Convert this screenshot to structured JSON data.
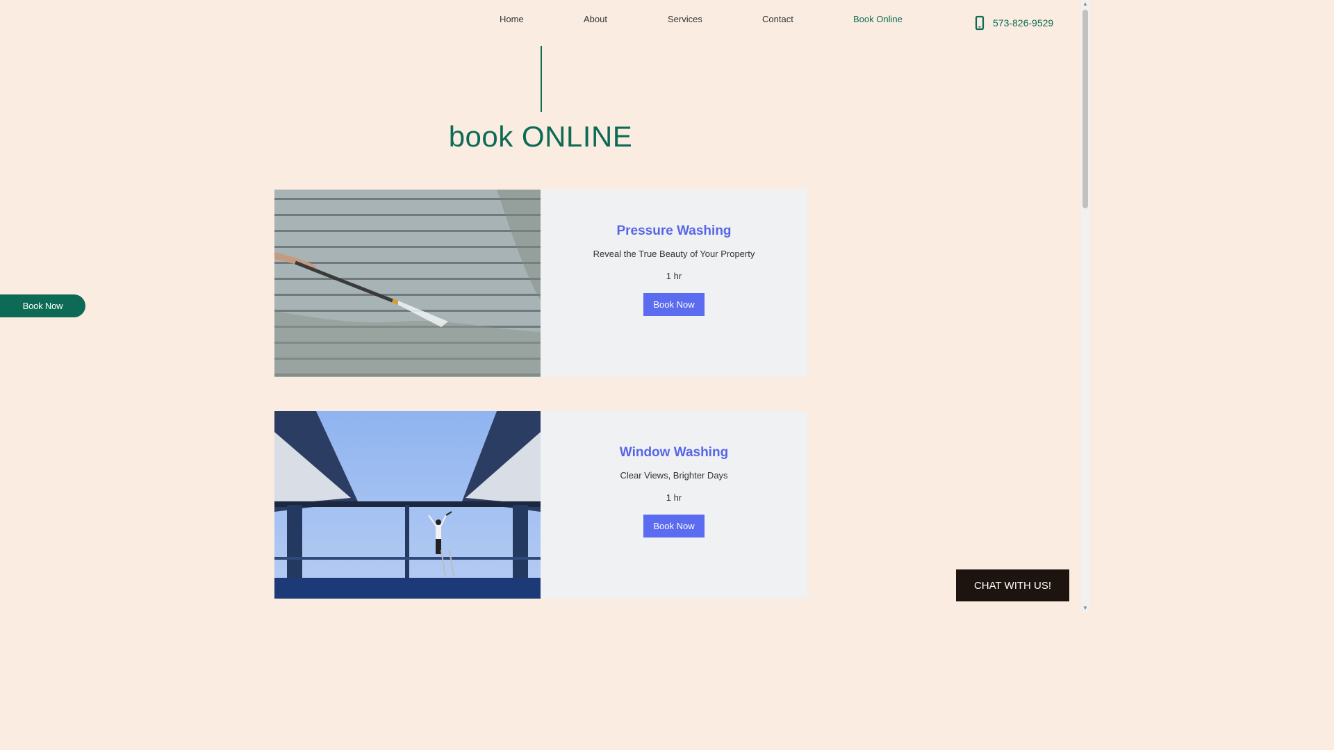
{
  "nav": {
    "items": [
      {
        "label": "Home"
      },
      {
        "label": "About"
      },
      {
        "label": "Services"
      },
      {
        "label": "Contact"
      },
      {
        "label": "Book Online",
        "active": true
      }
    ],
    "phone": {
      "icon": "phone-icon",
      "number": "573-826-9529"
    }
  },
  "page": {
    "title": "book ONLINE"
  },
  "services": [
    {
      "title": "Pressure Washing",
      "subtitle": "Reveal the True Beauty of Your Property",
      "duration": "1 hr",
      "button": "Book Now",
      "image": "pressure-washing-photo"
    },
    {
      "title": "Window Washing",
      "subtitle": "Clear Views, Brighter Days",
      "duration": "1 hr",
      "button": "Book Now",
      "image": "window-washing-photo"
    }
  ],
  "side_button": {
    "label": "Book Now"
  },
  "chat": {
    "label": "CHAT WITH US!"
  },
  "colors": {
    "background": "#faece1",
    "accent": "#0d6b55",
    "service_title": "#5665e8",
    "button": "#5b6cf0",
    "chat_bg": "#1d1410"
  }
}
